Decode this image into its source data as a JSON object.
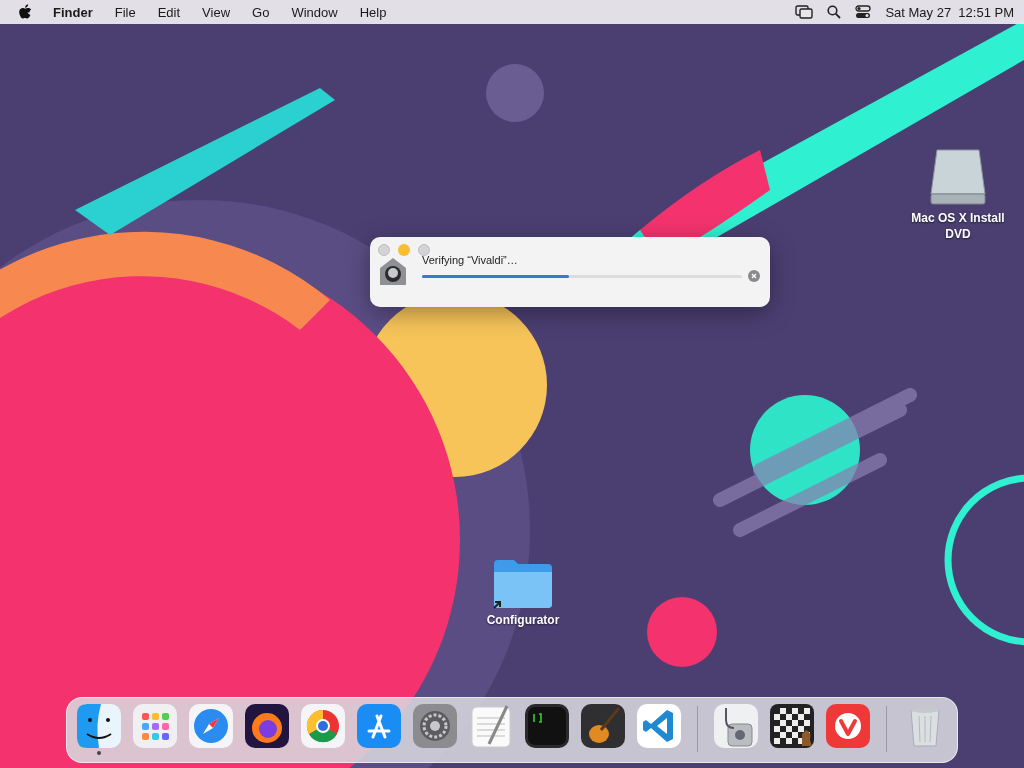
{
  "menu_bar": {
    "app_name": "Finder",
    "menus": [
      "File",
      "Edit",
      "View",
      "Go",
      "Window",
      "Help"
    ],
    "clock": "Sat May 27  12:51 PM"
  },
  "desktop_icons": [
    {
      "kind": "drive",
      "label": "Mac OS X Install DVD"
    },
    {
      "kind": "folder",
      "label": "Configurator"
    }
  ],
  "progress_window": {
    "message": "Verifying “Vivaldi”…",
    "level": 0.46
  },
  "dock": {
    "apps": [
      {
        "kind": "finder",
        "running": true
      },
      {
        "kind": "launchpad",
        "running": false
      },
      {
        "kind": "safari",
        "running": false
      },
      {
        "kind": "firefox",
        "running": false
      },
      {
        "kind": "chrome",
        "running": false
      },
      {
        "kind": "appstore",
        "running": false
      },
      {
        "kind": "settings",
        "running": false
      },
      {
        "kind": "textedit",
        "running": false
      },
      {
        "kind": "terminal",
        "running": false
      },
      {
        "kind": "guitar",
        "running": false
      },
      {
        "kind": "vscode",
        "running": false
      },
      {
        "kind": "divider"
      },
      {
        "kind": "diskutility",
        "running": false
      },
      {
        "kind": "chess",
        "running": false
      },
      {
        "kind": "vivaldi",
        "running": false
      },
      {
        "kind": "divider"
      },
      {
        "kind": "trash",
        "running": false
      }
    ]
  }
}
